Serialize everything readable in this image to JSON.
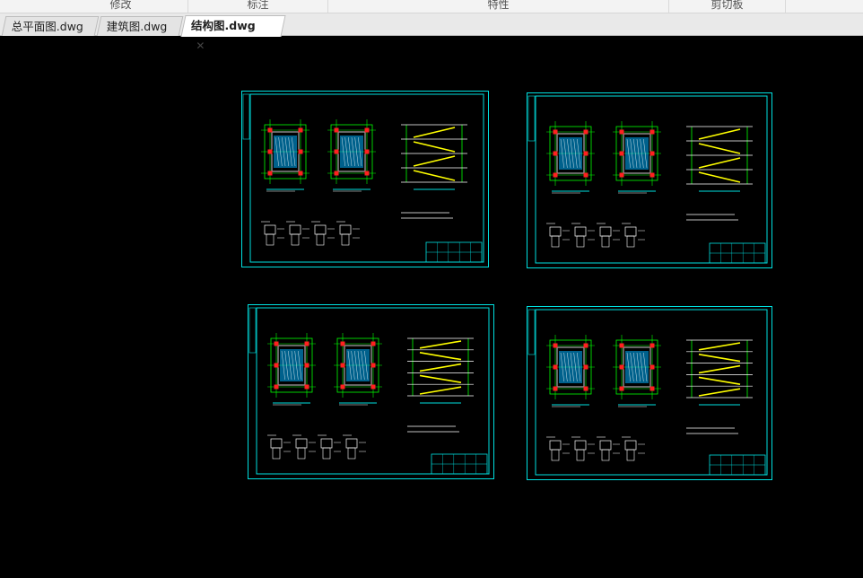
{
  "ribbon": {
    "sections": [
      "修改",
      "标注",
      "特性",
      "剪切板"
    ]
  },
  "tabs": [
    {
      "label": "总平面图.dwg",
      "active": false
    },
    {
      "label": "建筑图.dwg",
      "active": false
    },
    {
      "label": "结构图.dwg",
      "active": true
    }
  ],
  "close_icon": "close-icon",
  "colors": {
    "canvas_bg": "#000000",
    "frame": "#00e0e0",
    "axis": "#00ff00",
    "stair": "#ffff00",
    "column": "#ff2020",
    "slab": "#00b0ff"
  },
  "drawing_sheets_count": 4
}
